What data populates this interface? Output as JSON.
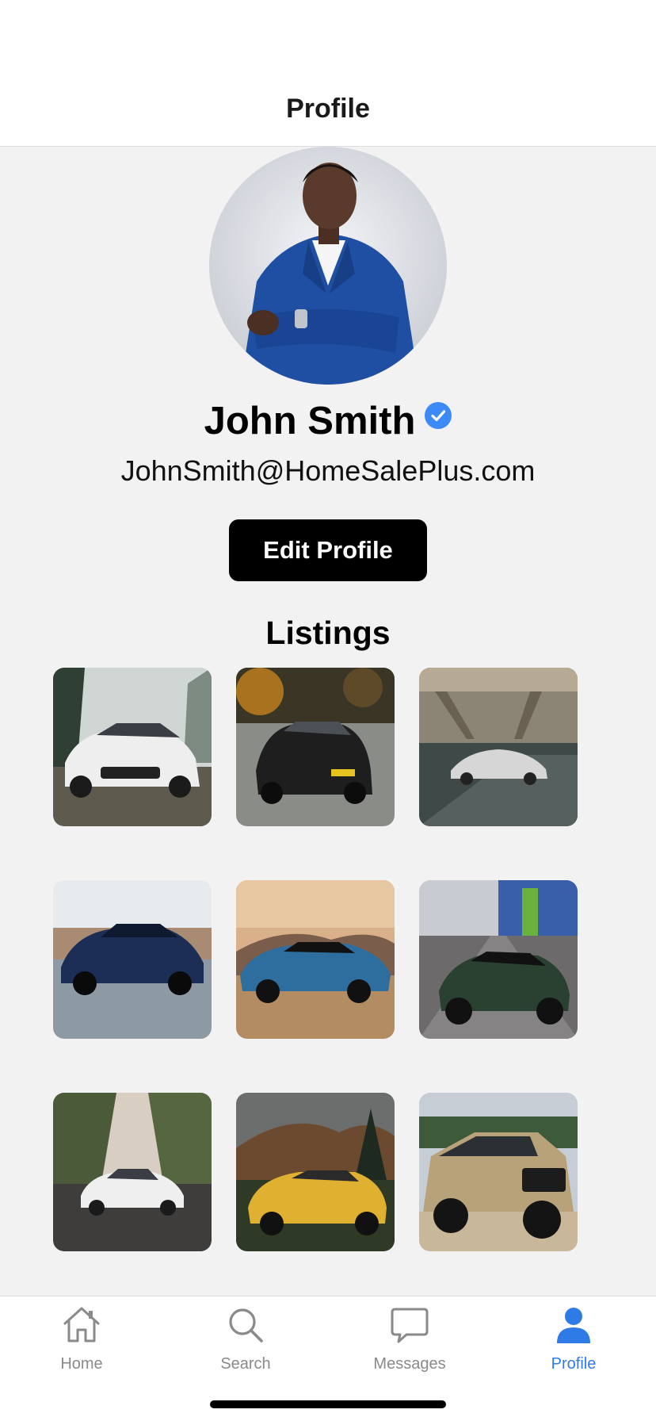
{
  "header": {
    "title": "Profile"
  },
  "profile": {
    "name": "John Smith",
    "email": "JohnSmith@HomeSalePlus.com",
    "verified_icon": "verified-check-icon",
    "edit_button_label": "Edit Profile"
  },
  "listings": {
    "title": "Listings",
    "items": [
      {
        "name": "white-sedan",
        "color": "#e8e8e8"
      },
      {
        "name": "black-hatchback",
        "color": "#1e1e1e"
      },
      {
        "name": "silver-sports-car",
        "color": "#c9c9c9"
      },
      {
        "name": "blue-sedan",
        "color": "#1c2e55"
      },
      {
        "name": "blue-muscle-car",
        "color": "#2e6e9e"
      },
      {
        "name": "green-coupe",
        "color": "#2a4030"
      },
      {
        "name": "white-compact-sedan",
        "color": "#eeeeee"
      },
      {
        "name": "yellow-roadster",
        "color": "#e0b030"
      },
      {
        "name": "tan-pickup-truck",
        "color": "#b8a27a"
      }
    ]
  },
  "tabs": [
    {
      "label": "Home",
      "icon": "home-icon",
      "active": false
    },
    {
      "label": "Search",
      "icon": "search-icon",
      "active": false
    },
    {
      "label": "Messages",
      "icon": "message-bubble-icon",
      "active": false
    },
    {
      "label": "Profile",
      "icon": "person-icon",
      "active": true
    }
  ],
  "colors": {
    "accent": "#2f7be6",
    "verified": "#3d8af7",
    "button_bg": "#000000"
  }
}
